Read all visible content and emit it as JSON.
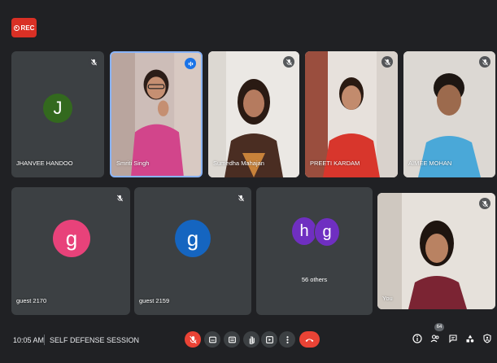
{
  "recording": {
    "label": "REC"
  },
  "participants": {
    "jhanvee": {
      "name": "JHANVEE HANDOO",
      "initial": "J",
      "avatar_color": "#33691e"
    },
    "smriti": {
      "name": "Smriti Singh"
    },
    "sumedha": {
      "name": "Sumedha Mahajan"
    },
    "preeti": {
      "name": "PREETI KARDAM"
    },
    "aimee": {
      "name": "AIMEE MOHAN"
    },
    "guest2170": {
      "name": "guest 2170",
      "initial": "g",
      "avatar_color": "#e8427a"
    },
    "guest2159": {
      "name": "guest 2159",
      "initial": "g",
      "avatar_color": "#1565c0"
    },
    "others": {
      "label": "56 others",
      "initial_1": "h",
      "initial_2": "g",
      "avatar_color": "#6f2fc1"
    },
    "you": {
      "name": "You"
    }
  },
  "bottom_bar": {
    "time": "10:05 AM",
    "meeting_title": "SELF DEFENSE SESSION",
    "participant_count": "64"
  },
  "colors": {
    "background": "#202124",
    "tile": "#3c4043",
    "danger": "#ea4335",
    "speaking": "#1a73e8"
  },
  "icons": [
    "record-icon",
    "mic-off-icon",
    "audio-level-icon",
    "captions-icon",
    "present-icon",
    "raise-hand-icon",
    "activities-icon",
    "more-options-icon",
    "end-call-icon",
    "info-icon",
    "people-icon",
    "chat-icon",
    "shapes-icon",
    "host-controls-icon"
  ]
}
